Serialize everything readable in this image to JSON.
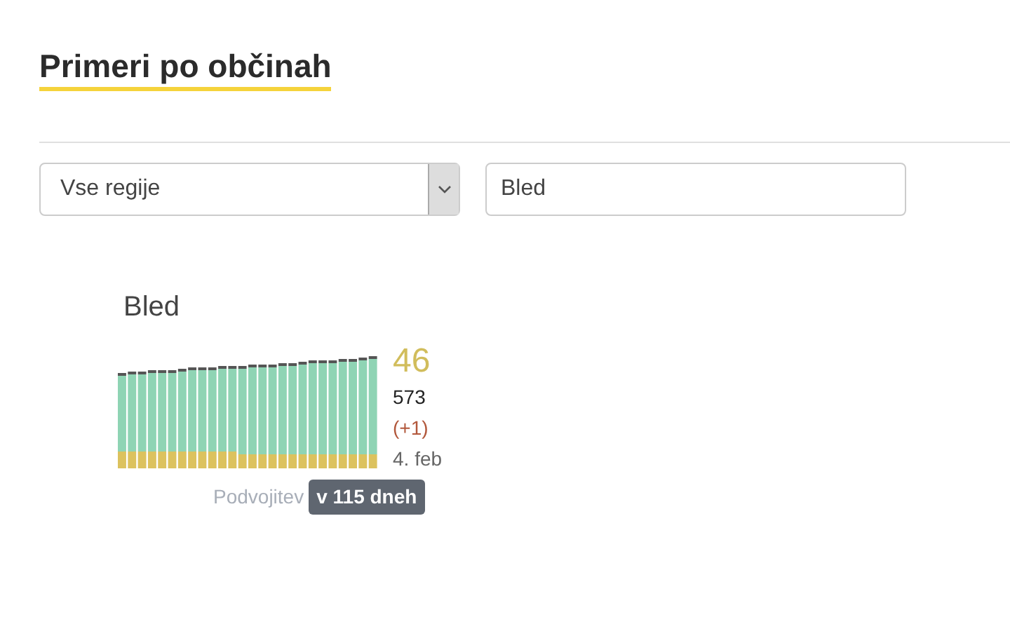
{
  "heading": "Primeri po občinah",
  "region_select": {
    "value": "Vse regije"
  },
  "search": {
    "value": "Bled"
  },
  "cards": [
    {
      "title": "Bled",
      "active": "46",
      "total": "573",
      "change": "(+1)",
      "date": "4. feb",
      "doubling_label": "Podvojitev",
      "doubling_value": "v 115 dneh"
    }
  ]
}
